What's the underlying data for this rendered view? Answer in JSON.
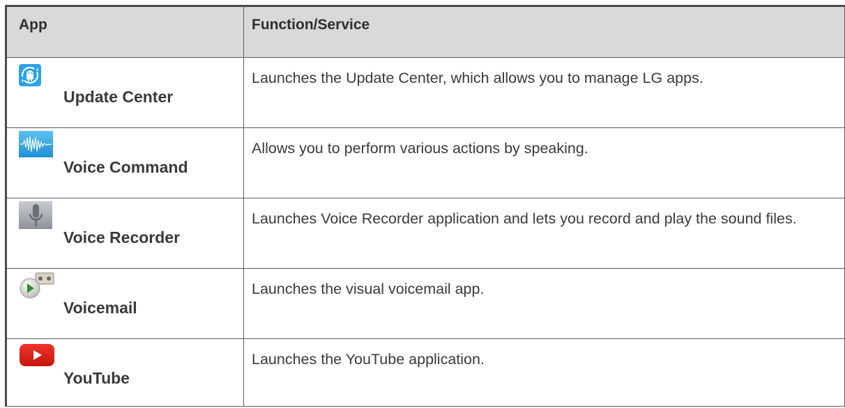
{
  "table": {
    "headers": {
      "app": "App",
      "function": "Function/Service"
    },
    "rows": [
      {
        "icon": "update-center-icon",
        "name": "Update Center",
        "function": "Launches the Update Center, which allows you to manage LG apps."
      },
      {
        "icon": "voice-command-icon",
        "name": "Voice Command",
        "function": "Allows you to perform various actions by speaking."
      },
      {
        "icon": "voice-recorder-icon",
        "name": "Voice Recorder",
        "function": "Launches Voice Recorder application and lets you record and play the sound files."
      },
      {
        "icon": "voicemail-icon",
        "name": "Voicemail",
        "function": "Launches the visual voicemail app."
      },
      {
        "icon": "youtube-icon",
        "name": "YouTube",
        "function": "Launches the YouTube application."
      }
    ]
  },
  "colors": {
    "header_bg": "#d9d9d9",
    "border": "#5a5a5a",
    "text": "#3a3a3a",
    "youtube_red": "#e62117",
    "update_blue": "#2aa2e8"
  }
}
